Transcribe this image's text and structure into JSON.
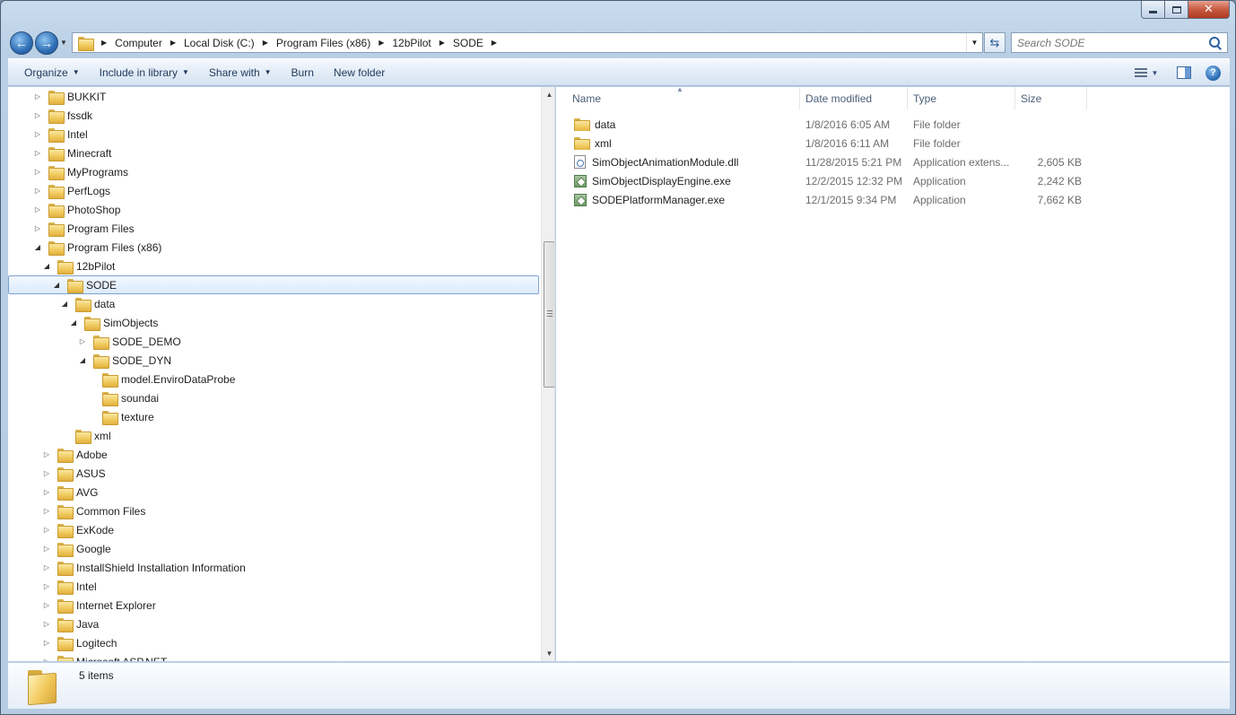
{
  "window": {
    "caption": {
      "min": "",
      "max": "",
      "close": "✕"
    }
  },
  "nav": {
    "back": "←",
    "forward": "→",
    "breadcrumbs": [
      "Computer",
      "Local Disk (C:)",
      "Program Files (x86)",
      "12bPilot",
      "SODE"
    ],
    "search_placeholder": "Search SODE"
  },
  "toolbar": {
    "organize": "Organize",
    "include_in_library": "Include in library",
    "share_with": "Share with",
    "burn": "Burn",
    "new_folder": "New folder"
  },
  "tree": [
    {
      "label": "BUKKIT",
      "level": 0,
      "expander": "closed"
    },
    {
      "label": "fssdk",
      "level": 0,
      "expander": "closed"
    },
    {
      "label": "Intel",
      "level": 0,
      "expander": "closed"
    },
    {
      "label": "Minecraft",
      "level": 0,
      "expander": "closed"
    },
    {
      "label": "MyPrograms",
      "level": 0,
      "expander": "closed"
    },
    {
      "label": "PerfLogs",
      "level": 0,
      "expander": "closed"
    },
    {
      "label": "PhotoShop",
      "level": 0,
      "expander": "closed"
    },
    {
      "label": "Program Files",
      "level": 0,
      "expander": "closed"
    },
    {
      "label": "Program Files (x86)",
      "level": 0,
      "expander": "open"
    },
    {
      "label": "12bPilot",
      "level": 1,
      "expander": "open"
    },
    {
      "label": "SODE",
      "level": 2,
      "expander": "open",
      "selected": true
    },
    {
      "label": "data",
      "level": 3,
      "expander": "open"
    },
    {
      "label": "SimObjects",
      "level": 4,
      "expander": "open"
    },
    {
      "label": "SODE_DEMO",
      "level": 5,
      "expander": "closed"
    },
    {
      "label": "SODE_DYN",
      "level": 5,
      "expander": "open"
    },
    {
      "label": "model.EnviroDataProbe",
      "level": 6,
      "expander": "none"
    },
    {
      "label": "soundai",
      "level": 6,
      "expander": "none"
    },
    {
      "label": "texture",
      "level": 6,
      "expander": "none"
    },
    {
      "label": "xml",
      "level": 3,
      "expander": "none"
    },
    {
      "label": "Adobe",
      "level": 1,
      "expander": "closed"
    },
    {
      "label": "ASUS",
      "level": 1,
      "expander": "closed"
    },
    {
      "label": "AVG",
      "level": 1,
      "expander": "closed"
    },
    {
      "label": "Common Files",
      "level": 1,
      "expander": "closed"
    },
    {
      "label": "ExKode",
      "level": 1,
      "expander": "closed"
    },
    {
      "label": "Google",
      "level": 1,
      "expander": "closed"
    },
    {
      "label": "InstallShield Installation Information",
      "level": 1,
      "expander": "closed"
    },
    {
      "label": "Intel",
      "level": 1,
      "expander": "closed"
    },
    {
      "label": "Internet Explorer",
      "level": 1,
      "expander": "closed"
    },
    {
      "label": "Java",
      "level": 1,
      "expander": "closed"
    },
    {
      "label": "Logitech",
      "level": 1,
      "expander": "closed"
    },
    {
      "label": "Microsoft ASP.NET",
      "level": 1,
      "expander": "closed"
    }
  ],
  "columns": {
    "name": "Name",
    "date": "Date modified",
    "type": "Type",
    "size": "Size"
  },
  "files": [
    {
      "name": "data",
      "date": "1/8/2016 6:05 AM",
      "type": "File folder",
      "size": "",
      "icon": "folder-icon"
    },
    {
      "name": "xml",
      "date": "1/8/2016 6:11 AM",
      "type": "File folder",
      "size": "",
      "icon": "folder-icon"
    },
    {
      "name": "SimObjectAnimationModule.dll",
      "date": "11/28/2015 5:21 PM",
      "type": "Application extens...",
      "size": "2,605 KB",
      "icon": "dll-icon"
    },
    {
      "name": "SimObjectDisplayEngine.exe",
      "date": "12/2/2015 12:32 PM",
      "type": "Application",
      "size": "2,242 KB",
      "icon": "exe-icon"
    },
    {
      "name": "SODEPlatformManager.exe",
      "date": "12/1/2015 9:34 PM",
      "type": "Application",
      "size": "7,662 KB",
      "icon": "exe-icon"
    }
  ],
  "details": {
    "items_count": "5 items"
  }
}
